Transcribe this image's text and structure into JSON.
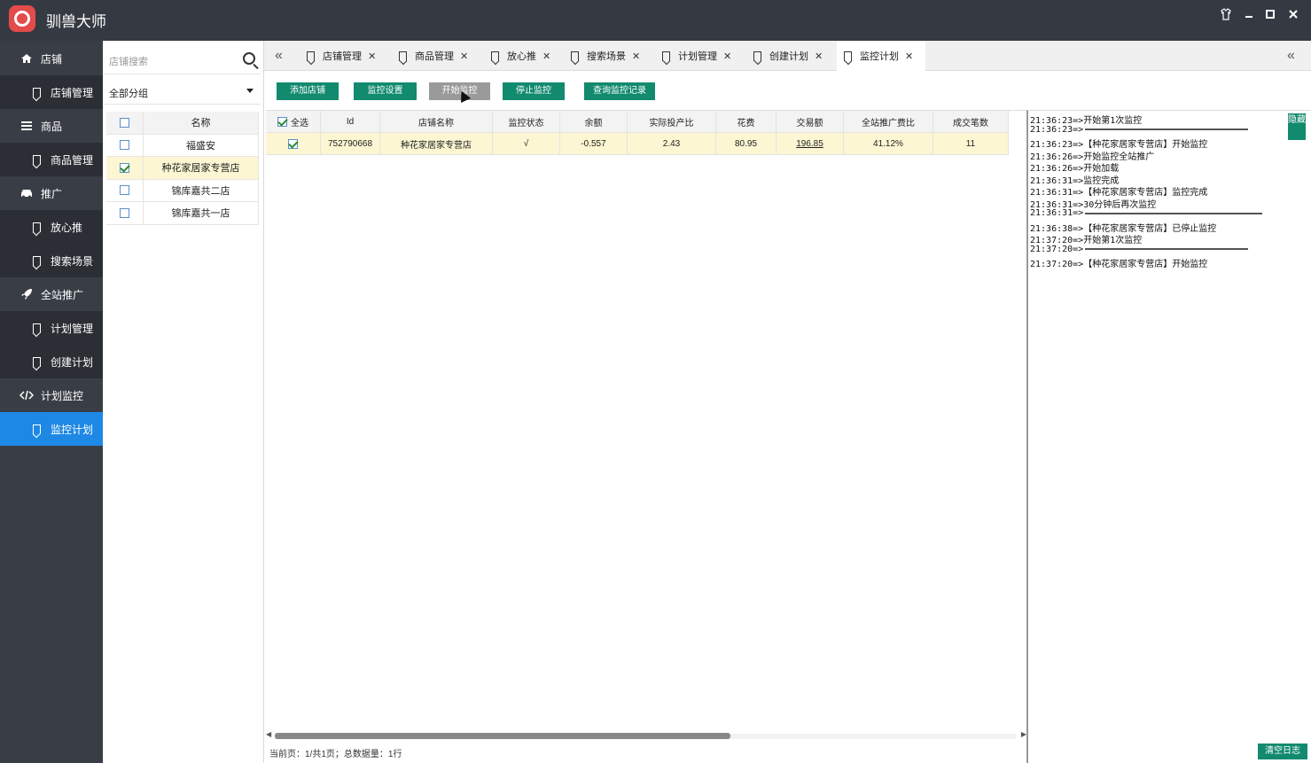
{
  "app": {
    "title": "驯兽大师"
  },
  "nav": {
    "items": [
      {
        "label": "店铺",
        "icon": "home-icon",
        "level": "group"
      },
      {
        "label": "店铺管理",
        "icon": "bookmark-icon",
        "level": "sub"
      },
      {
        "label": "商品",
        "icon": "list-icon",
        "level": "group"
      },
      {
        "label": "商品管理",
        "icon": "bookmark-icon",
        "level": "sub"
      },
      {
        "label": "推广",
        "icon": "car-icon",
        "level": "group"
      },
      {
        "label": "放心推",
        "icon": "bookmark-icon",
        "level": "sub"
      },
      {
        "label": "搜索场景",
        "icon": "bookmark-icon",
        "level": "sub"
      },
      {
        "label": "全站推广",
        "icon": "rocket-icon",
        "level": "group"
      },
      {
        "label": "计划管理",
        "icon": "bookmark-icon",
        "level": "sub"
      },
      {
        "label": "创建计划",
        "icon": "bookmark-icon",
        "level": "sub"
      },
      {
        "label": "计划监控",
        "icon": "code-icon",
        "level": "group"
      },
      {
        "label": "监控计划",
        "icon": "bookmark-icon",
        "level": "sub",
        "active": true
      }
    ]
  },
  "store_panel": {
    "search_placeholder": "店铺搜索",
    "group_select": "全部分组",
    "header": "名称",
    "stores": [
      {
        "name": "福盛安",
        "checked": false
      },
      {
        "name": "种花家居家专营店",
        "checked": true
      },
      {
        "name": "锦库嘉共二店",
        "checked": false
      },
      {
        "name": "锦库嘉共一店",
        "checked": false
      }
    ]
  },
  "tabs": [
    {
      "label": "店铺管理"
    },
    {
      "label": "商品管理"
    },
    {
      "label": "放心推"
    },
    {
      "label": "搜索场景"
    },
    {
      "label": "计划管理"
    },
    {
      "label": "创建计划"
    },
    {
      "label": "监控计划",
      "active": true
    }
  ],
  "toolbar": {
    "add_store": "添加店铺",
    "monitor_settings": "监控设置",
    "start_monitor": "开始监控",
    "stop_monitor": "停止监控",
    "query_records": "查询监控记录"
  },
  "grid": {
    "select_all": "全选",
    "columns": [
      "Id",
      "店铺名称",
      "监控状态",
      "余额",
      "实际投产比",
      "花费",
      "交易额",
      "全站推广费比",
      "成交笔数"
    ],
    "rows": [
      [
        "752790668",
        "种花家居家专营店",
        "√",
        "-0.557",
        "2.43",
        "80.95",
        "196.85",
        "41.12%",
        "11"
      ]
    ]
  },
  "footer": {
    "status": "当前页：1/共1页；总数据量：1行"
  },
  "log": {
    "hide_label": "隐藏",
    "clear_label": "清空日志",
    "lines": [
      "21:36:23=>开始第1次监控",
      "21:36:23=>",
      "21:36:23=>【种花家居家专营店】开始监控",
      "21:36:26=>开始监控全站推广",
      "21:36:26=>开始加载",
      "21:36:31=>监控完成",
      "21:36:31=>【种花家居家专营店】监控完成",
      "21:36:31=>30分钟后再次监控",
      "21:36:31=>",
      "21:36:38=>【种花家居家专营店】已停止监控",
      "21:37:20=>开始第1次监控",
      "21:37:20=>",
      "21:37:20=>【种花家居家专营店】开始监控"
    ]
  }
}
